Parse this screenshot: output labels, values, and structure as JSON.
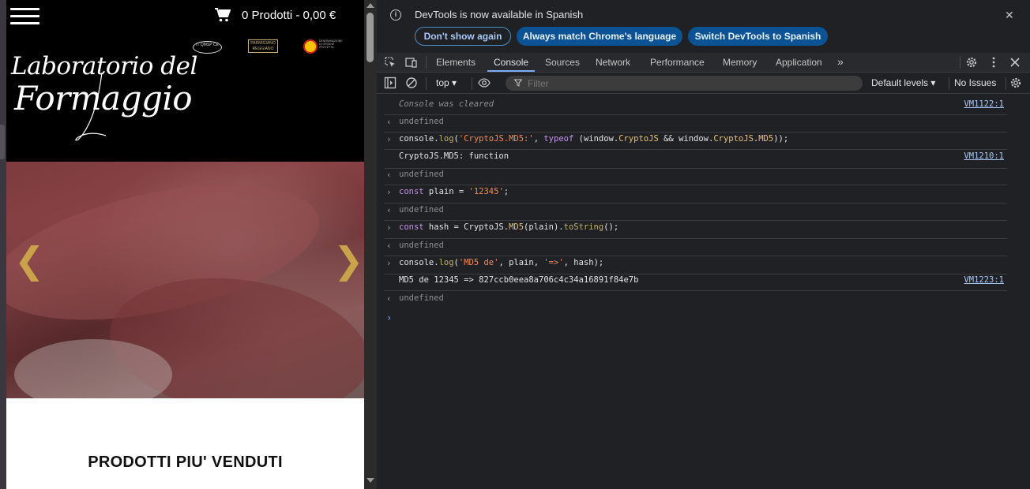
{
  "site": {
    "cart_text": "0 Prodotti - 0,00 €",
    "logo_line1": "Laboratorio del",
    "logo_line2": "Formaggio",
    "badges": {
      "qmsp": "IT QMSP CE",
      "parmigiano": "PARMIGIANO REGGIANO",
      "dop": "DENOMINAZIONE DI ORIGINE PROTETTA"
    },
    "carousel": {
      "prev_icon": "chevron-left-icon",
      "next_icon": "chevron-right-icon",
      "prev_glyph": "❮",
      "next_glyph": "❯"
    },
    "section_title": "PRODOTTI PIU' VENDUTI"
  },
  "devtools": {
    "infobar": {
      "message": "DevTools is now available in Spanish",
      "btn_dont_show": "Don't show again",
      "btn_match": "Always match Chrome's language",
      "btn_switch": "Switch DevTools to Spanish",
      "close": "✕"
    },
    "tabs": [
      "Elements",
      "Console",
      "Sources",
      "Network",
      "Performance",
      "Memory",
      "Application"
    ],
    "active_tab": "Console",
    "more_tabs": "»",
    "toolbar": {
      "context": "top ▾",
      "filter_placeholder": "Filter",
      "levels": "Default levels ▾",
      "issues": "No Issues"
    },
    "console": {
      "cleared": "Console was cleared",
      "cleared_src": "VM1122:1",
      "undefined": "undefined",
      "cmd1_a": "console.",
      "cmd1_log": "log",
      "cmd1_b": "(",
      "cmd1_str": "'CryptoJS.MD5:'",
      "cmd1_c": ", ",
      "cmd1_typeof": "typeof",
      "cmd1_d": " (window.",
      "cmd1_cj": "CryptoJS",
      "cmd1_e": " && window.",
      "cmd1_cj2": "CryptoJS",
      "cmd1_f": ".",
      "cmd1_md5": "MD5",
      "cmd1_g": "));",
      "out1": "CryptoJS.MD5: function",
      "out1_src": "VM1210:1",
      "cmd2_const": "const",
      "cmd2_name": " plain",
      "cmd2_eq": " = ",
      "cmd2_str": "'12345'",
      "cmd2_end": ";",
      "cmd3_const": "const",
      "cmd3_name": " hash",
      "cmd3_eq": " = CryptoJS.",
      "cmd3_md5": "MD5",
      "cmd3_mid": "(plain).",
      "cmd3_tostr": "toString",
      "cmd3_end": "();",
      "cmd4_a": "console.",
      "cmd4_log": "log",
      "cmd4_b": "(",
      "cmd4_str1": "'MD5 de'",
      "cmd4_c": ", plain, ",
      "cmd4_str2": "'=>'",
      "cmd4_d": ", hash);",
      "out4": "MD5 de 12345 => 827ccb0eea8a706c4c34a16891f84e7b",
      "out4_src": "VM1223:1",
      "prompt": "›"
    }
  }
}
